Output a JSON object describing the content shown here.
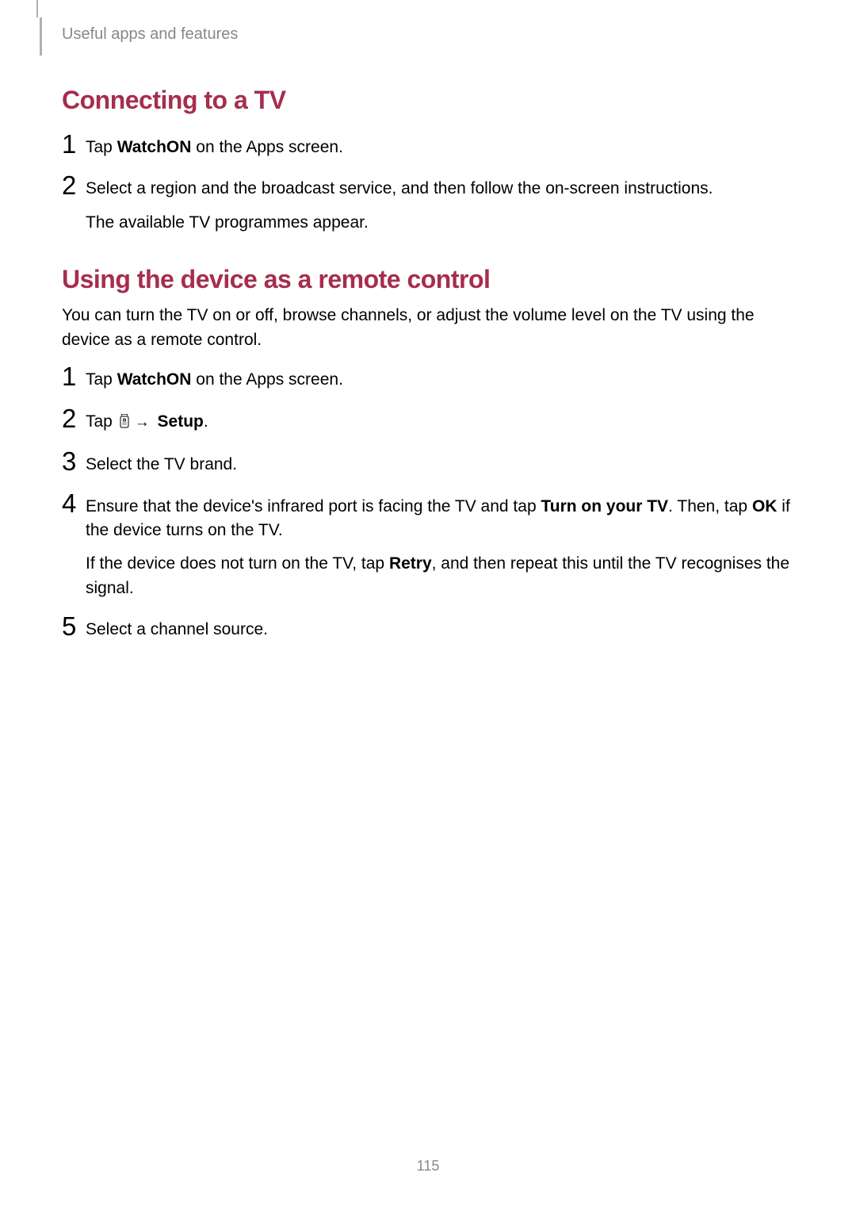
{
  "header": {
    "breadcrumb": "Useful apps and features"
  },
  "section1": {
    "heading": "Connecting to a TV",
    "steps": [
      {
        "num": "1",
        "line1_pre": "Tap ",
        "line1_bold": "WatchON",
        "line1_post": " on the Apps screen."
      },
      {
        "num": "2",
        "line1": "Select a region and the broadcast service, and then follow the on-screen instructions.",
        "line2": "The available TV programmes appear."
      }
    ]
  },
  "section2": {
    "heading": "Using the device as a remote control",
    "intro": "You can turn the TV on or off, browse channels, or adjust the volume level on the TV using the device as a remote control.",
    "steps": [
      {
        "num": "1",
        "line1_pre": "Tap ",
        "line1_bold": "WatchON",
        "line1_post": " on the Apps screen."
      },
      {
        "num": "2",
        "line2_pre": "Tap ",
        "line2_icon": "remote-icon",
        "line2_arrow": "→",
        "line2_bold": "Setup",
        "line2_post": "."
      },
      {
        "num": "3",
        "line1": "Select the TV brand."
      },
      {
        "num": "4",
        "line4a_pre": "Ensure that the device's infrared port is facing the TV and tap ",
        "line4a_bold": "Turn on your TV",
        "line4a_mid": ". Then, tap ",
        "line4a_bold2": "OK",
        "line4a_post": " if the device turns on the TV.",
        "line4b_pre": "If the device does not turn on the TV, tap ",
        "line4b_bold": "Retry",
        "line4b_post": ", and then repeat this until the TV recognises the signal."
      },
      {
        "num": "5",
        "line1": "Select a channel source."
      }
    ]
  },
  "page_number": "115"
}
